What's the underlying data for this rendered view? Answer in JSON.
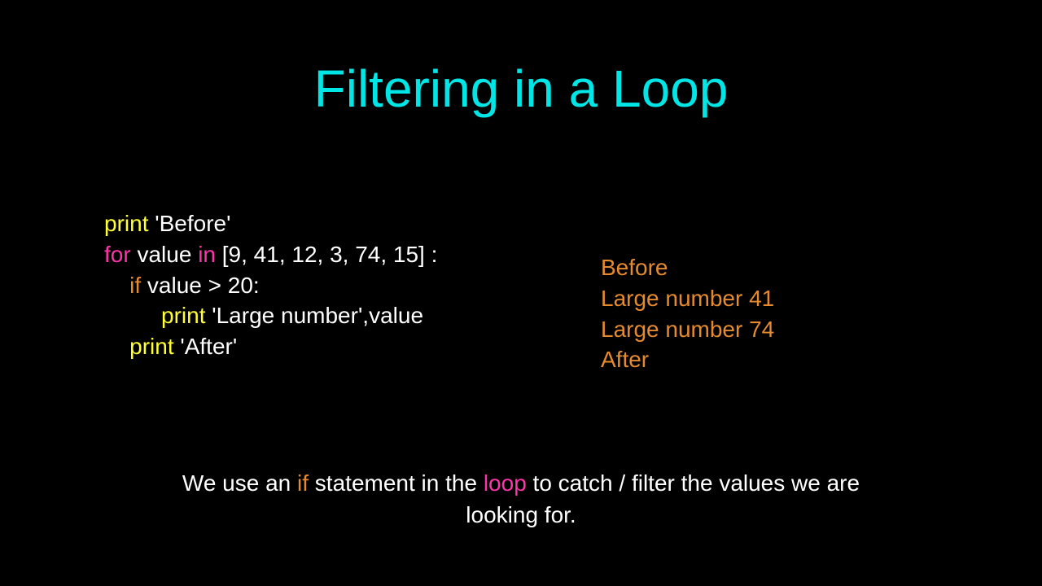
{
  "title": "Filtering in a Loop",
  "code": {
    "l1": {
      "a": "print",
      "b": " 'Before'"
    },
    "l2": {
      "a": "for",
      "b": " value ",
      "c": "in",
      "d": " [9, 41, 12, 3, 74, 15] :"
    },
    "l3": {
      "pad": "    ",
      "a": "if",
      "b": " value > 20:"
    },
    "l4": {
      "pad": "         ",
      "a": "print",
      "b": " 'Large number',",
      "c": "value"
    },
    "l5": {
      "pad": "    ",
      "a": "print",
      "b": " 'After'"
    }
  },
  "output": [
    "Before",
    "Large number 41",
    "Large number 74",
    "After"
  ],
  "footer": {
    "a": "We use an ",
    "b": "if",
    "c": " statement in the ",
    "d": "loop",
    "e": " to catch / filter the values we are looking for."
  }
}
